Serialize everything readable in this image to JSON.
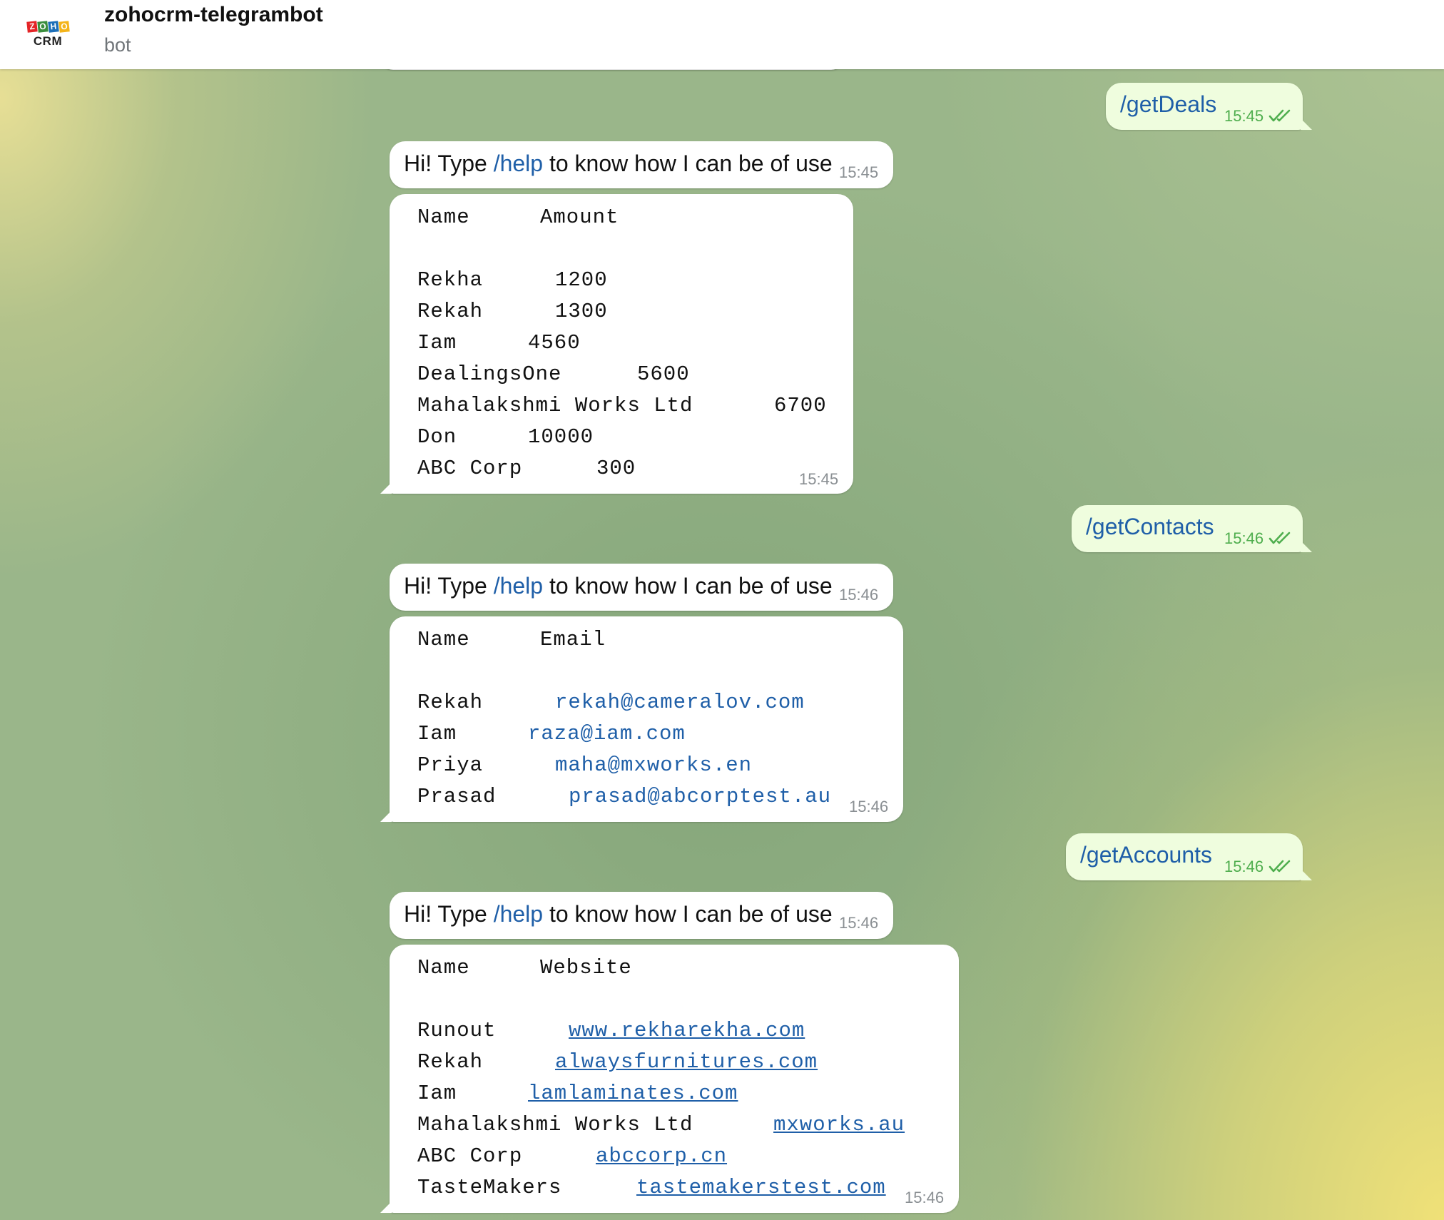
{
  "header": {
    "title": "zohocrm-telegrambot",
    "subtitle": "bot",
    "avatar": {
      "tiles": [
        "Z",
        "O",
        "H",
        "O"
      ],
      "label": "CRM",
      "tile_colors": [
        "#e42527",
        "#3a8e3d",
        "#1d6fb8",
        "#f4b41a"
      ]
    }
  },
  "messages": {
    "cmd_deals": {
      "text": "/getDeals",
      "time": "15:45"
    },
    "greet1": {
      "prefix": "Hi! Type ",
      "link": "/help",
      "suffix": " to know how I can be of use",
      "time": "15:45"
    },
    "deals": {
      "col1": "Name",
      "col2": "Amount",
      "time": "15:45",
      "rows": [
        {
          "name": "Rekha",
          "value": "1200"
        },
        {
          "name": "Rekah",
          "value": "1300"
        },
        {
          "name": "Iam",
          "value": "4560"
        },
        {
          "name": "DealingsOne",
          "value": "5600"
        },
        {
          "name": "Mahalakshmi Works Ltd",
          "value": "6700"
        },
        {
          "name": "Don",
          "value": "10000"
        },
        {
          "name": "ABC Corp",
          "value": "300"
        }
      ]
    },
    "cmd_contacts": {
      "text": "/getContacts",
      "time": "15:46"
    },
    "greet2": {
      "prefix": "Hi! Type ",
      "link": "/help",
      "suffix": " to know how I can be of use",
      "time": "15:46"
    },
    "contacts": {
      "col1": "Name",
      "col2": "Email",
      "time": "15:46",
      "rows": [
        {
          "name": "Rekah",
          "value": "rekah@cameralov.com"
        },
        {
          "name": "Iam",
          "value": "raza@iam.com"
        },
        {
          "name": "Priya",
          "value": "maha@mxworks.en"
        },
        {
          "name": "Prasad",
          "value": "prasad@abcorptest.au"
        }
      ]
    },
    "cmd_accounts": {
      "text": "/getAccounts",
      "time": "15:46"
    },
    "greet3": {
      "prefix": "Hi! Type ",
      "link": "/help",
      "suffix": " to know how I can be of use",
      "time": "15:46"
    },
    "accounts": {
      "col1": "Name",
      "col2": "Website",
      "time": "15:46",
      "rows": [
        {
          "name": "Runout",
          "value": "www.rekharekha.com"
        },
        {
          "name": "Rekah",
          "value": "alwaysfurnitures.com"
        },
        {
          "name": "Iam",
          "value": "lamlaminates.com"
        },
        {
          "name": "Mahalakshmi Works Ltd",
          "value": "mxworks.au"
        },
        {
          "name": "ABC Corp",
          "value": "abccorp.cn"
        },
        {
          "name": "TasteMakers",
          "value": "tastemakerstest.com"
        }
      ]
    }
  }
}
